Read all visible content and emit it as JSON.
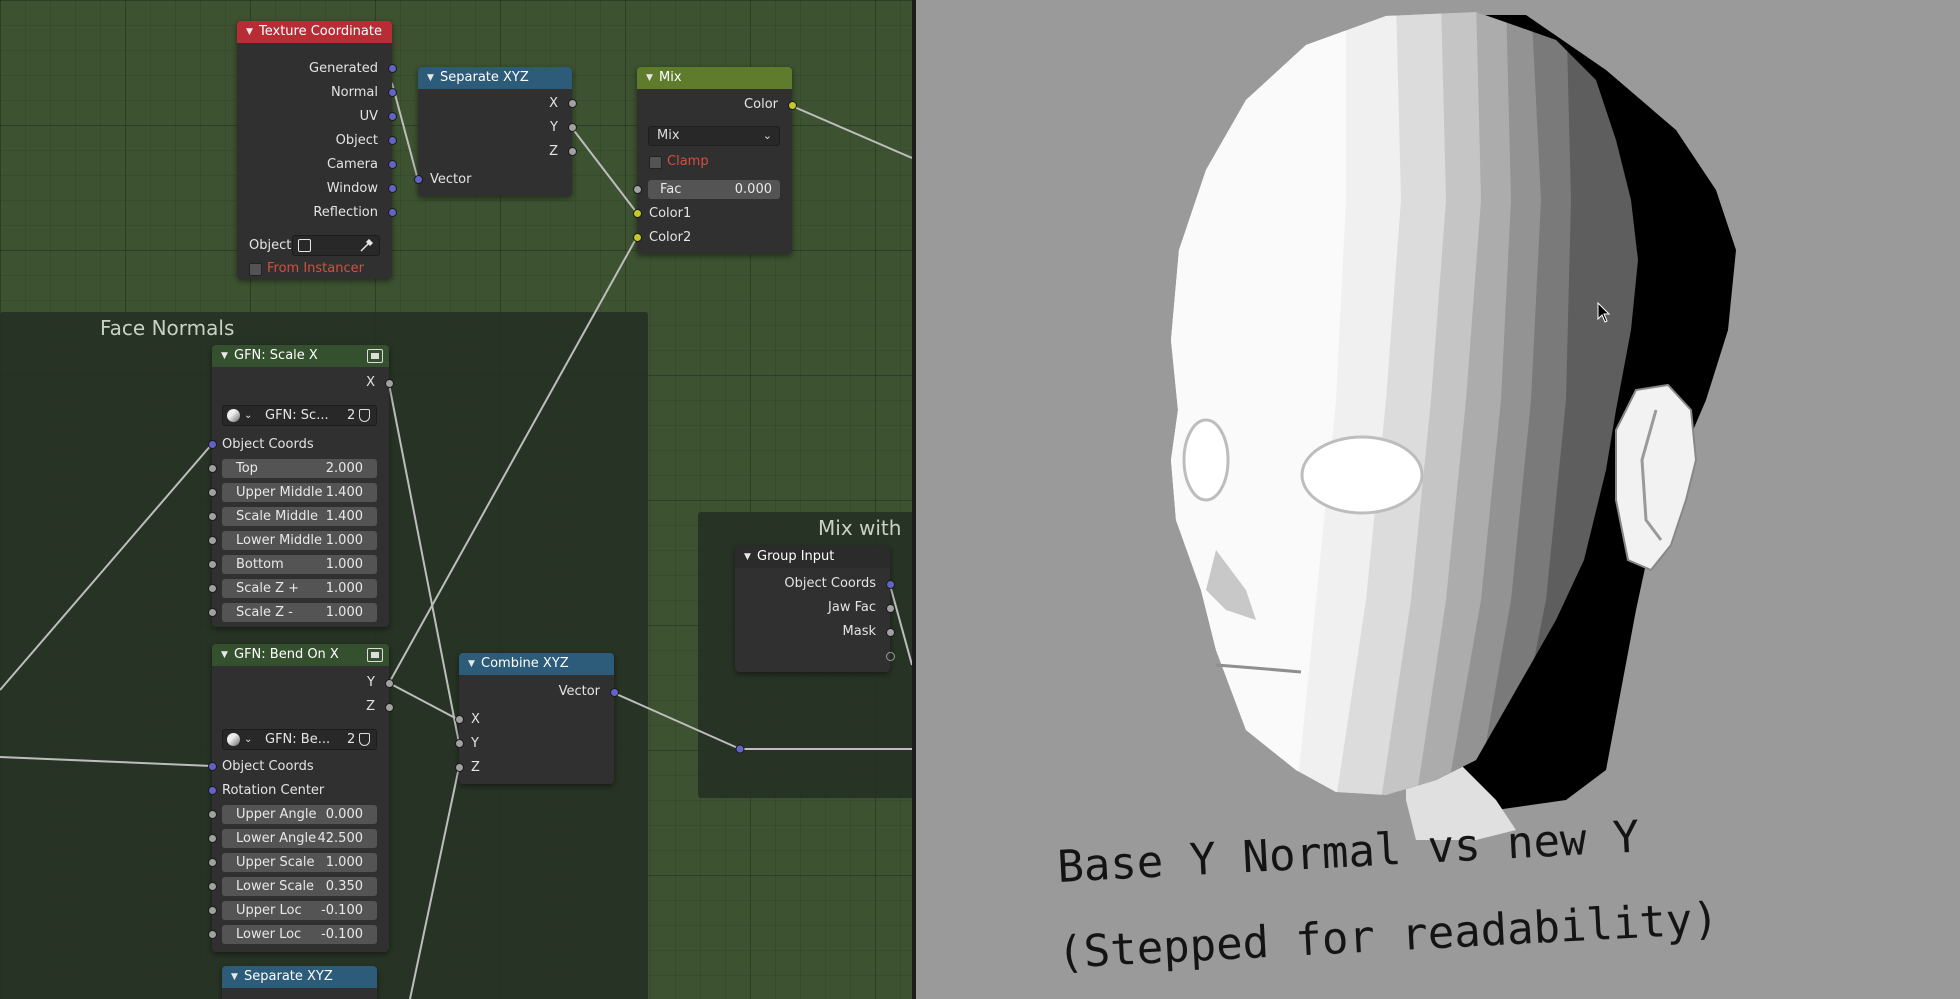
{
  "node_editor": {
    "frames": {
      "face_normals": "Face Normals",
      "mix_with": "Mix with"
    },
    "texture_coordinate": {
      "title": "Texture Coordinate",
      "outputs": [
        "Generated",
        "Normal",
        "UV",
        "Object",
        "Camera",
        "Window",
        "Reflection"
      ],
      "object_label": "Object:",
      "from_instancer": "From Instancer"
    },
    "separate_xyz_top": {
      "title": "Separate XYZ",
      "outputs": [
        "X",
        "Y",
        "Z"
      ],
      "input": "Vector"
    },
    "mix": {
      "title": "Mix",
      "output": "Color",
      "blend_mode": "Mix",
      "clamp": "Clamp",
      "fac_label": "Fac",
      "fac_value": "0.000",
      "inputs": [
        "Color1",
        "Color2"
      ]
    },
    "gfn_scale_x": {
      "title": "GFN: Scale X",
      "output": "X",
      "datablock_name": "GFN: Sc...",
      "datablock_users": "2",
      "object_coords": "Object Coords",
      "params": [
        {
          "label": "Top",
          "value": "2.000"
        },
        {
          "label": "Upper Middle",
          "value": "1.400"
        },
        {
          "label": "Scale Middle",
          "value": "1.400"
        },
        {
          "label": "Lower Middle",
          "value": "1.000"
        },
        {
          "label": "Bottom",
          "value": "1.000"
        },
        {
          "label": "Scale Z +",
          "value": "1.000"
        },
        {
          "label": "Scale Z -",
          "value": "1.000"
        }
      ]
    },
    "gfn_bend_on_x": {
      "title": "GFN: Bend On X",
      "outputs": [
        "Y",
        "Z"
      ],
      "datablock_name": "GFN: Be...",
      "datablock_users": "2",
      "object_coords": "Object Coords",
      "rotation_center": "Rotation Center",
      "params": [
        {
          "label": "Upper Angle",
          "value": "0.000"
        },
        {
          "label": "Lower Angle",
          "value": "42.500"
        },
        {
          "label": "Upper Scale",
          "value": "1.000"
        },
        {
          "label": "Lower Scale",
          "value": "0.350"
        },
        {
          "label": "Upper Loc",
          "value": "-0.100"
        },
        {
          "label": "Lower Loc",
          "value": "-0.100"
        }
      ]
    },
    "combine_xyz": {
      "title": "Combine XYZ",
      "output": "Vector",
      "inputs": [
        "X",
        "Y",
        "Z"
      ]
    },
    "group_input": {
      "title": "Group Input",
      "outputs": [
        "Object Coords",
        "Jaw Fac",
        "Mask"
      ]
    },
    "separate_xyz_bottom": {
      "title": "Separate XYZ"
    }
  },
  "viewport": {
    "caption_line1": "Base Y Normal vs new Y",
    "caption_line2": "(Stepped for readability)"
  },
  "colors": {
    "input_header": "#b72c35",
    "converter_header": "#2c5c79",
    "color_header": "#5f7b2c",
    "group_header": "#35502e",
    "vector_socket": "#6363c7",
    "float_socket": "#a1a1a1",
    "color_socket": "#c7c729",
    "editor_background": "#3c5230",
    "viewport_background": "#9a9a9a"
  },
  "icons": [
    "object-data-icon",
    "eyedropper-icon",
    "group-node-icon",
    "material-sphere-icon",
    "shield-icon",
    "chevron-down-icon",
    "mouse-cursor-icon"
  ]
}
